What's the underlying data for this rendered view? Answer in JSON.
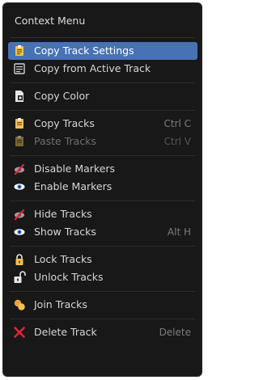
{
  "menu": {
    "title": "Context Menu",
    "items": [
      {
        "label": "Copy Track Settings",
        "shortcut": "",
        "icon": "copy-settings-icon"
      },
      {
        "label": "Copy from Active Track",
        "shortcut": "",
        "icon": "copy-from-active-icon"
      },
      {
        "label": "Copy Color",
        "shortcut": "",
        "icon": "copy-color-icon"
      },
      {
        "label": "Copy Tracks",
        "shortcut": "Ctrl C",
        "icon": "copy-icon"
      },
      {
        "label": "Paste Tracks",
        "shortcut": "Ctrl V",
        "icon": "paste-icon"
      },
      {
        "label": "Disable Markers",
        "shortcut": "",
        "icon": "hide-on-icon"
      },
      {
        "label": "Enable Markers",
        "shortcut": "",
        "icon": "hide-off-icon"
      },
      {
        "label": "Hide Tracks",
        "shortcut": "",
        "icon": "hide-on-icon"
      },
      {
        "label": "Show Tracks",
        "shortcut": "Alt H",
        "icon": "hide-off-icon"
      },
      {
        "label": "Lock Tracks",
        "shortcut": "",
        "icon": "locked-icon"
      },
      {
        "label": "Unlock Tracks",
        "shortcut": "",
        "icon": "unlocked-icon"
      },
      {
        "label": "Join Tracks",
        "shortcut": "",
        "icon": "join-icon"
      },
      {
        "label": "Delete Track",
        "shortcut": "Delete",
        "icon": "delete-icon"
      }
    ]
  },
  "colors": {
    "background": "#181818",
    "highlight": "#4772b3",
    "text": "#d6d6d6",
    "disabled_text": "#6f6f6f",
    "shortcut_text": "#7c7c7c"
  }
}
